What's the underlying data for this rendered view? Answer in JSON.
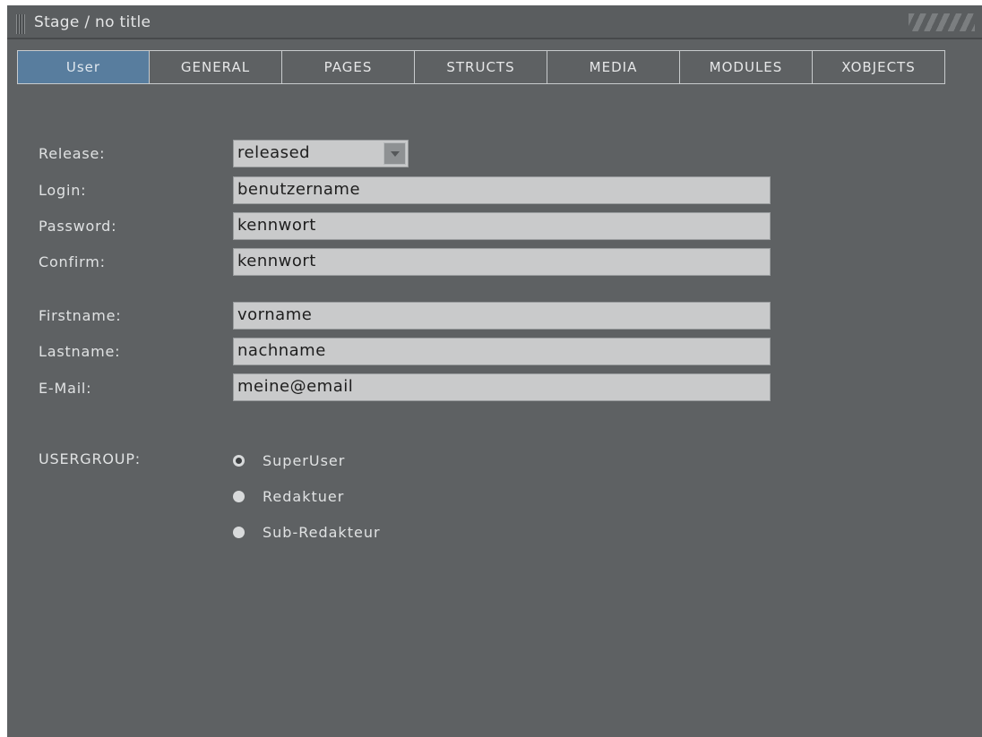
{
  "window": {
    "title": "Stage / no title"
  },
  "tabs": [
    {
      "label": "User",
      "active": true
    },
    {
      "label": "GENERAL",
      "active": false
    },
    {
      "label": "PAGES",
      "active": false
    },
    {
      "label": "STRUCTS",
      "active": false
    },
    {
      "label": "MEDIA",
      "active": false
    },
    {
      "label": "MODULES",
      "active": false
    },
    {
      "label": "XOBJECTS",
      "active": false
    }
  ],
  "form": {
    "release": {
      "label": "Release:",
      "value": "released"
    },
    "login": {
      "label": "Login:",
      "value": "benutzername"
    },
    "password": {
      "label": "Password:",
      "value": "kennwort"
    },
    "confirm": {
      "label": "Confirm:",
      "value": "kennwort"
    },
    "firstname": {
      "label": "Firstname:",
      "value": "vorname"
    },
    "lastname": {
      "label": "Lastname:",
      "value": "nachname"
    },
    "email": {
      "label": "E-Mail:",
      "value": "meine@email"
    },
    "usergroup": {
      "label": "USERGROUP:",
      "options": [
        {
          "label": "SuperUser",
          "selected": true
        },
        {
          "label": "Redaktuer",
          "selected": false
        },
        {
          "label": "Sub-Redakteur",
          "selected": false
        }
      ]
    }
  },
  "colors": {
    "background": "#5e6163",
    "active_tab": "#587d9e",
    "field_background": "#c9cacb"
  }
}
